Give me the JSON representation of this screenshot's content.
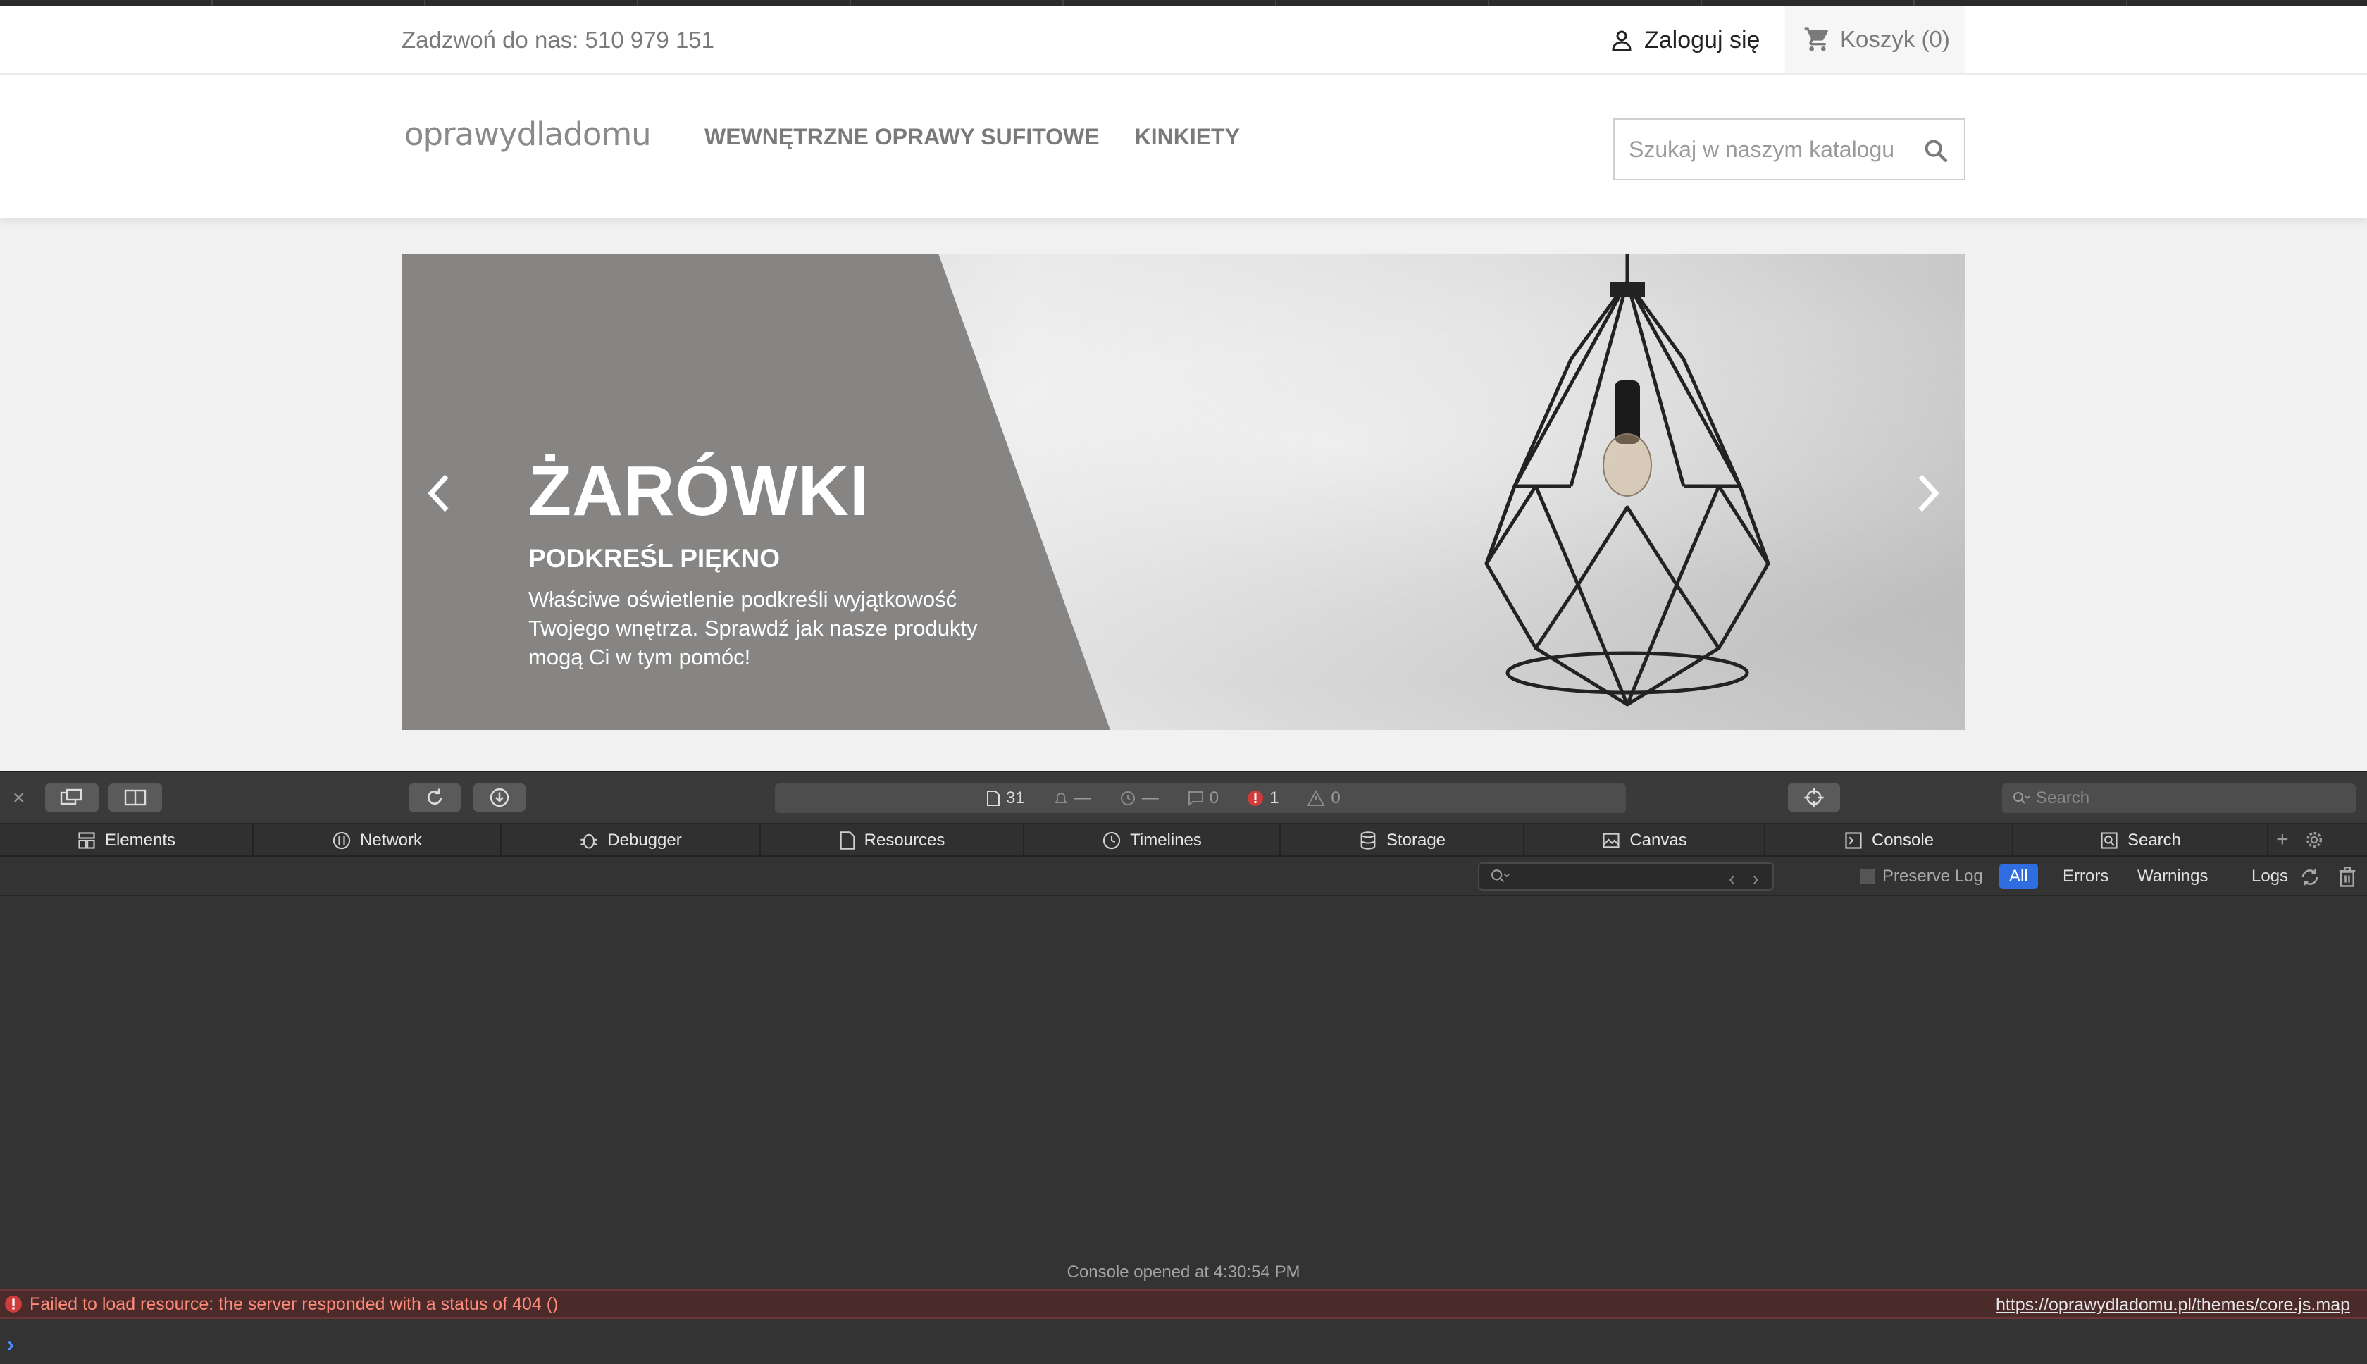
{
  "site": {
    "phone_text": "Zadzwoń do nas: 510 979 151",
    "login_label": "Zaloguj się",
    "cart_label": "Koszyk (0)",
    "logo_text": "oprawydladomu",
    "nav": [
      {
        "label": "WEWNĘTRZNE OPRAWY SUFITOWE"
      },
      {
        "label": "KINKIETY"
      }
    ],
    "search_placeholder": "Szukaj w naszym katalogu",
    "slide": {
      "title": "ŻARÓWKI",
      "subtitle": "PODKREŚL PIĘKNO",
      "text": "Właściwe oświetlenie podkreśli wyjątkowość Twojego wnętrza. Sprawdź jak nasze produkty mogą Ci w tym pomóc!"
    }
  },
  "devtools": {
    "status": {
      "resources": "31",
      "time_a": "—",
      "time_b": "—",
      "messages": "0",
      "errors": "1",
      "warnings": "0"
    },
    "search_placeholder": "Search",
    "tabs": [
      {
        "label": "Elements",
        "icon": "elements-icon"
      },
      {
        "label": "Network",
        "icon": "network-icon"
      },
      {
        "label": "Debugger",
        "icon": "debugger-icon"
      },
      {
        "label": "Resources",
        "icon": "resources-icon"
      },
      {
        "label": "Timelines",
        "icon": "timelines-icon"
      },
      {
        "label": "Storage",
        "icon": "storage-icon"
      },
      {
        "label": "Canvas",
        "icon": "canvas-icon"
      },
      {
        "label": "Console",
        "icon": "console-icon"
      },
      {
        "label": "Search",
        "icon": "search-icon"
      }
    ],
    "filter": {
      "preserve_log": "Preserve Log",
      "levels": [
        "All",
        "Errors",
        "Warnings",
        "Logs"
      ],
      "active_level": "All"
    },
    "console": {
      "opened_text": "Console opened at 4:30:54 PM",
      "error_message": "Failed to load resource: the server responded with a status of 404 ()",
      "error_link": "https://oprawydladomu.pl/themes/core.js.map"
    }
  },
  "colors": {
    "accent": "#2f6de1",
    "error_text": "#ff8a7a",
    "slide_panel": "#868584"
  }
}
